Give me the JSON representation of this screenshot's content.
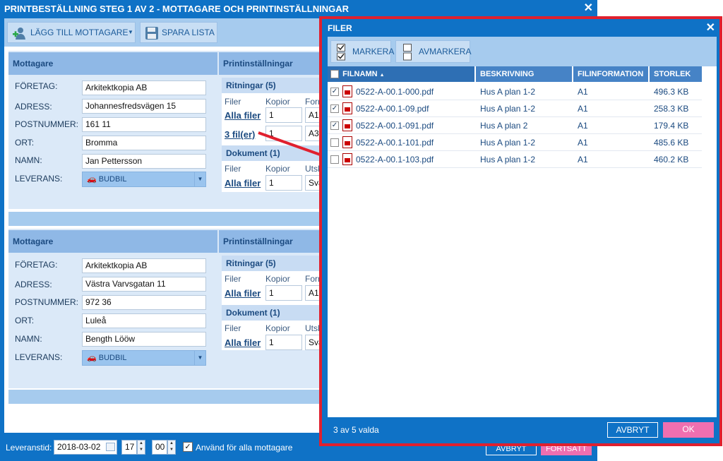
{
  "window": {
    "title": "PRINTBESTÄLLNING STEG 1 AV 2 - MOTTAGARE OCH PRINTINSTÄLLNINGAR",
    "close_icon": "✕"
  },
  "toolbar": {
    "add_recipient_label": "LÄGG TILL MOTTAGARE",
    "save_list_label": "SPARA LISTA"
  },
  "labels": {
    "recipient_header": "Mottagare",
    "print_settings_header": "Printinställningar",
    "company": "FÖRETAG:",
    "address": "ADRESS:",
    "postcode": "POSTNUMMER:",
    "city": "ORT:",
    "name": "NAMN:",
    "delivery": "LEVERANS:",
    "files_col": "Filer",
    "copies_col": "Kopior",
    "format_col": "Form",
    "output_col": "Utsk",
    "all_files": "Alla filer"
  },
  "recipients": [
    {
      "company": "Arkitektkopia AB",
      "address": "Johannesfredsvägen 15",
      "postcode": "161 11",
      "city": "Bromma",
      "name": "Jan Pettersson",
      "delivery": "BUDBIL",
      "drawings_header": "Ritningar (5)",
      "documents_header": "Dokument (1)",
      "drawing_rows": [
        {
          "files": "Alla filer",
          "copies": "1",
          "format": "A1"
        },
        {
          "files": "3 fil(er)",
          "copies": "1",
          "format": "A3"
        }
      ],
      "document_rows": [
        {
          "files": "Alla filer",
          "copies": "1",
          "output": "Sva"
        }
      ]
    },
    {
      "company": "Arkitektkopia AB",
      "address": "Västra Varvsgatan 11",
      "postcode": "972 36",
      "city": "Luleå",
      "name": "Bength Lööw",
      "delivery": "BUDBIL",
      "drawings_header": "Ritningar (5)",
      "documents_header": "Dokument (1)",
      "drawing_rows": [
        {
          "files": "Alla filer",
          "copies": "1",
          "format": "A1"
        }
      ],
      "document_rows": [
        {
          "files": "Alla filer",
          "copies": "1",
          "output": "Sva"
        }
      ]
    }
  ],
  "footer": {
    "delivery_time_label": "Leveranstid:",
    "date": "2018-03-02",
    "hour": "17",
    "minute": "00",
    "apply_all_label": "Använd för alla mottagare",
    "cancel_label": "AVBRYT",
    "continue_label": "FORTSÄTT"
  },
  "modal": {
    "title": "FILER",
    "select_label": "MARKERA",
    "deselect_label": "AVMARKERA",
    "columns": {
      "filename": "FILNAMN",
      "description": "BESKRIVNING",
      "fileinfo": "FILINFORMATION",
      "size": "STORLEK"
    },
    "files": [
      {
        "name": "0522-A-00.1-000.pdf",
        "description": "Hus A plan 1-2",
        "info": "A1",
        "size": "496.3 KB",
        "checked": true
      },
      {
        "name": "0522-A-00.1-09.pdf",
        "description": "Hus A plan 1-2",
        "info": "A1",
        "size": "258.3 KB",
        "checked": true
      },
      {
        "name": "0522-A-00.1-091.pdf",
        "description": "Hus A plan 2",
        "info": "A1",
        "size": "179.4 KB",
        "checked": true
      },
      {
        "name": "0522-A-00.1-101.pdf",
        "description": "Hus A plan 1-2",
        "info": "A1",
        "size": "485.6 KB",
        "checked": false
      },
      {
        "name": "0522-A-00.1-103.pdf",
        "description": "Hus A plan 1-2",
        "info": "A1",
        "size": "460.2 KB",
        "checked": false
      }
    ],
    "selection_status": "3 av 5 valda",
    "cancel_label": "AVBRYT",
    "ok_label": "OK"
  },
  "colors": {
    "window_blue": "#0f72c6",
    "annotation_red": "#e0202e",
    "ok_pink": "#f06fb0"
  }
}
